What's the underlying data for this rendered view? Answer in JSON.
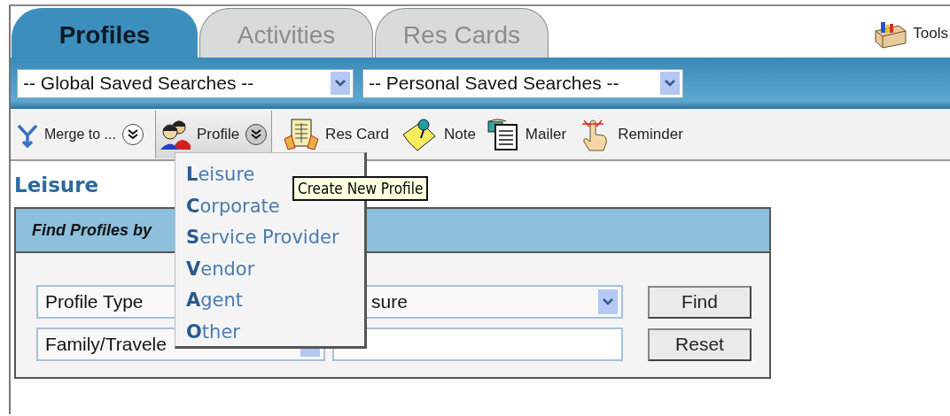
{
  "tabs": [
    {
      "label": "Profiles",
      "selected": true
    },
    {
      "label": "Activities",
      "selected": false
    },
    {
      "label": "Res Cards",
      "selected": false
    }
  ],
  "tools": {
    "label": "Tools"
  },
  "saved_searches": [
    {
      "value": "-- Global Saved Searches --"
    },
    {
      "value": "-- Personal Saved Searches --"
    }
  ],
  "toolbar": [
    {
      "kind": "merge",
      "label": "Merge to ...",
      "dropdown": true,
      "expanded": false
    },
    {
      "kind": "profile",
      "label": "Profile",
      "dropdown": true,
      "expanded": true
    },
    {
      "kind": "card",
      "label": "Res Card",
      "dropdown": false,
      "expanded": false
    },
    {
      "kind": "note",
      "label": "Note",
      "dropdown": false,
      "expanded": false
    },
    {
      "kind": "mailer",
      "label": "Mailer",
      "dropdown": false,
      "expanded": false
    },
    {
      "kind": "reminder",
      "label": "Reminder",
      "dropdown": false,
      "expanded": false
    }
  ],
  "heading": "Leisure",
  "panel": {
    "title": "Find Profiles by",
    "rows": [
      {
        "field": {
          "value": "Profile Type"
        },
        "value": {
          "kind": "select",
          "value": "sure"
        },
        "button": "Find"
      },
      {
        "field": {
          "kind": "select",
          "value": "Family/Travele"
        },
        "value": {
          "kind": "text"
        },
        "button": "Reset"
      }
    ]
  },
  "menu": {
    "items": [
      "**L**eisure",
      "**C**orporate",
      "**S**ervice Provider",
      "**V**endor",
      "**A**gent",
      "**O**ther"
    ]
  },
  "tooltip": "Create New Profile"
}
